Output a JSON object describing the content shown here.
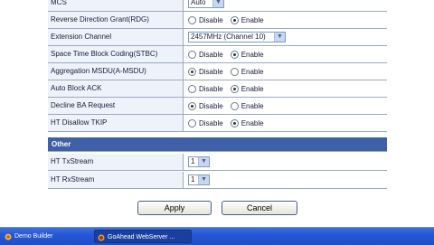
{
  "rows": [
    {
      "label": "MCS",
      "type": "select",
      "value": "Auto"
    },
    {
      "label": "Reverse Direction Grant(RDG)",
      "type": "radio",
      "options": [
        "Disable",
        "Enable"
      ],
      "selected": 1
    },
    {
      "label": "Extension Channel",
      "type": "select",
      "value": "2457MHz (Channel 10)"
    },
    {
      "label": "Space Time Block Coding(STBC)",
      "type": "radio",
      "options": [
        "Disable",
        "Enable"
      ],
      "selected": 1
    },
    {
      "label": "Aggregation MSDU(A-MSDU)",
      "type": "radio",
      "options": [
        "Disable",
        "Enable"
      ],
      "selected": 0
    },
    {
      "label": "Auto Block ACK",
      "type": "radio",
      "options": [
        "Disable",
        "Enable"
      ],
      "selected": 1
    },
    {
      "label": "Decline BA Request",
      "type": "radio",
      "options": [
        "Disable",
        "Enable"
      ],
      "selected": 0
    },
    {
      "label": "HT Disallow TKIP",
      "type": "radio",
      "options": [
        "Disable",
        "Enable"
      ],
      "selected": 1
    }
  ],
  "other": {
    "title": "Other",
    "rows": [
      {
        "label": "HT TxStream",
        "value": "1"
      },
      {
        "label": "HT RxStream",
        "value": "1"
      }
    ]
  },
  "buttons": {
    "apply": "Apply",
    "cancel": "Cancel"
  },
  "taskbar": {
    "task1": "Demo Builder",
    "task2": "GoAhead WebServer ..."
  }
}
